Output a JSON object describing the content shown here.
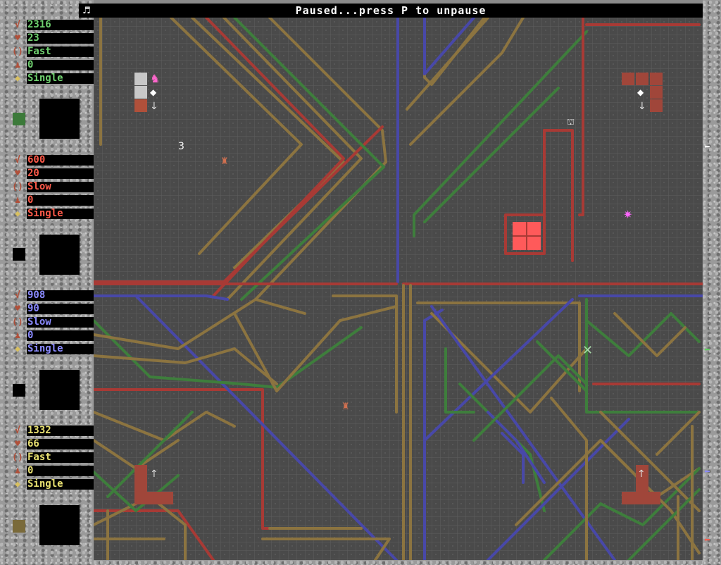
{
  "status": {
    "text": "Paused...press P to unpause",
    "music_icon": "♬"
  },
  "players": [
    {
      "id": "p1",
      "color": "#6fd06f",
      "swatch": "#3c7a3a",
      "points": "2316",
      "health": "23",
      "speed": "Fast",
      "count": "0",
      "mode": "Single",
      "arrow_color": "#ffffff"
    },
    {
      "id": "p2",
      "color": "#ff5a4a",
      "swatch": "#000000",
      "points": "600",
      "health": "20",
      "speed": "Slow",
      "count": "0",
      "mode": "Single",
      "arrow_color": "#5fd05f"
    },
    {
      "id": "p3",
      "color": "#8a8aff",
      "swatch": "#000000",
      "points": "908",
      "health": "90",
      "speed": "Slow",
      "count": "0",
      "mode": "Single",
      "arrow_color": "#8a8aff"
    },
    {
      "id": "p4",
      "color": "#e8e070",
      "swatch": "#7a6a3a",
      "points": "1332",
      "health": "66",
      "speed": "Fast",
      "count": "0",
      "mode": "Single",
      "arrow_color": "#ff5a4a"
    }
  ],
  "board": {
    "score_marker": "3"
  },
  "colors": {
    "red": "#a83a35",
    "green": "#3e7e3c",
    "blue": "#4848a8",
    "gold": "#8c7440",
    "grid": "#5c5c5c",
    "bg": "#4a4a4a"
  }
}
